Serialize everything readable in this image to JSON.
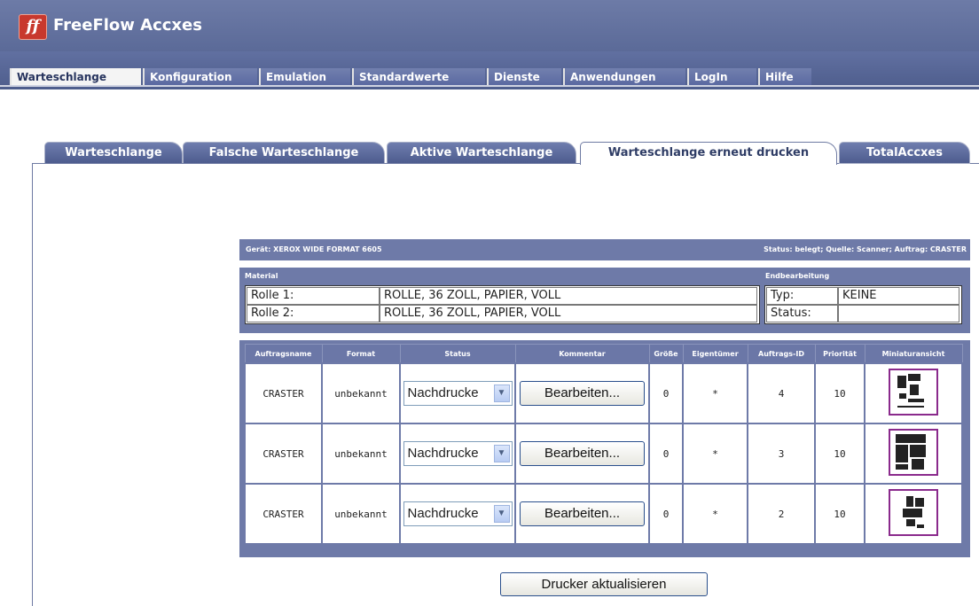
{
  "app": {
    "title": "FreeFlow Accxes",
    "logo_text": "ff"
  },
  "menu": [
    "Warteschlange",
    "Konfiguration",
    "Emulation",
    "Standardwerte",
    "Dienste",
    "Anwendungen",
    "LogIn",
    "Hilfe"
  ],
  "subtabs": [
    "Warteschlange",
    "Falsche Warteschlange",
    "Aktive Warteschlange",
    "Warteschlange erneut drucken",
    "TotalAccxes"
  ],
  "device": {
    "label": "Gerät:  XEROX WIDE FORMAT 6605",
    "status": "Status:  belegt; Quelle: Scanner; Auftrag: CRASTER"
  },
  "material": {
    "heading": "Material",
    "rows": [
      {
        "name": "Rolle 1:",
        "value": "ROLLE, 36 ZOLL, PAPIER, VOLL"
      },
      {
        "name": "Rolle 2:",
        "value": "ROLLE, 36 ZOLL, PAPIER, VOLL"
      }
    ]
  },
  "finishing": {
    "heading": "Endbearbeitung",
    "rows": [
      {
        "name": "Typ:",
        "value": "KEINE"
      },
      {
        "name": "Status:",
        "value": ""
      }
    ]
  },
  "jobs": {
    "headers": [
      "Auftragsname",
      "Format",
      "Status",
      "Kommentar",
      "Größe",
      "Eigentümer",
      "Auftrags-ID",
      "Priorität",
      "Miniaturansicht"
    ],
    "rows": [
      {
        "name": "CRASTER",
        "format": "unbekannt",
        "status": "Nachdrucke",
        "comment_button": "Bearbeiten...",
        "size": "0",
        "owner": "*",
        "id": "4",
        "priority": "10"
      },
      {
        "name": "CRASTER",
        "format": "unbekannt",
        "status": "Nachdrucke",
        "comment_button": "Bearbeiten...",
        "size": "0",
        "owner": "*",
        "id": "3",
        "priority": "10"
      },
      {
        "name": "CRASTER",
        "format": "unbekannt",
        "status": "Nachdrucke",
        "comment_button": "Bearbeiten...",
        "size": "0",
        "owner": "*",
        "id": "2",
        "priority": "10"
      }
    ]
  },
  "refresh_button": "Drucker aktualisieren",
  "colors": {
    "header": "#5b6a98",
    "panel": "#6e7aa8",
    "thumb_border": "#8a2a8c"
  }
}
